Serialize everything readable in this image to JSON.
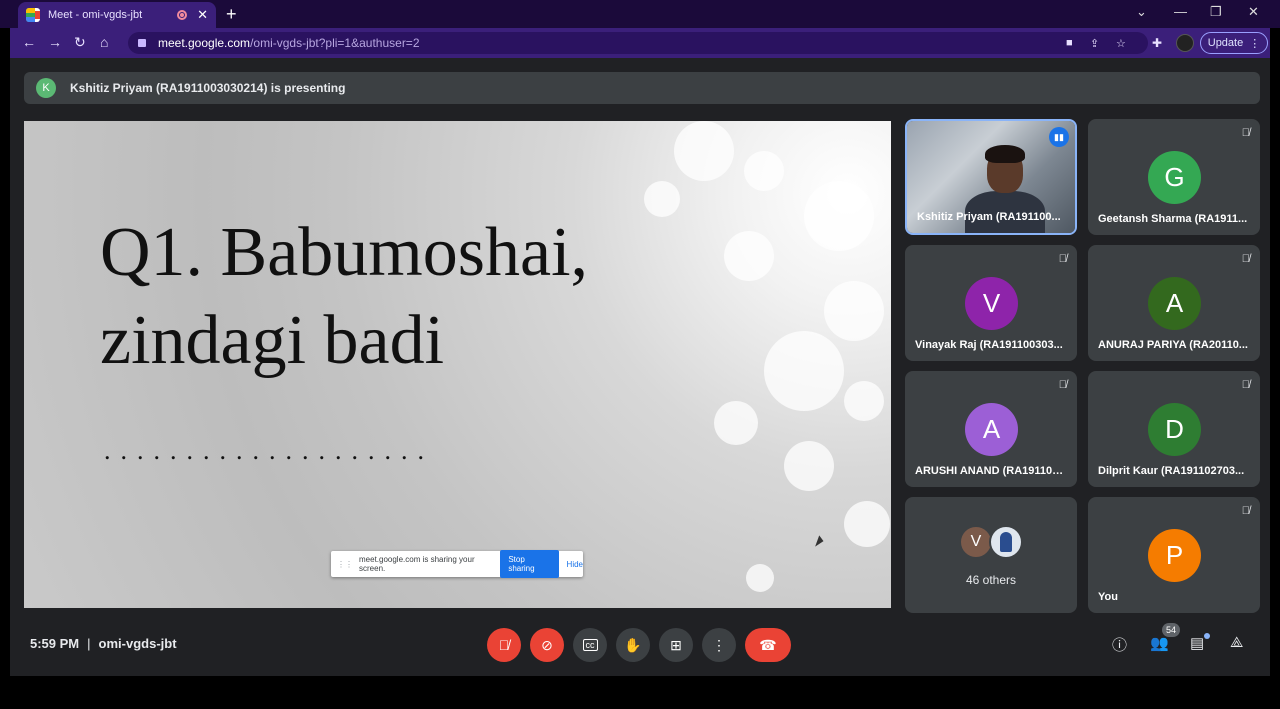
{
  "browser": {
    "tab_title": "Meet - omi-vgds-jbt",
    "new_tab": "+",
    "url_host": "meet.google.com",
    "url_path": "/omi-vgds-jbt?pli=1&authuser=2",
    "update_label": "Update"
  },
  "meet": {
    "banner_initial": "K",
    "banner_text": "Kshitiz Priyam (RA1911003030214) is presenting",
    "slide": {
      "line1": "Q1. Babumoshai,",
      "line2": "zindagi badi",
      "dots": "...................."
    },
    "share_bar": {
      "text": "meet.google.com is sharing your screen.",
      "stop": "Stop sharing",
      "hide": "Hide"
    },
    "participants": [
      {
        "name": "Kshitiz Priyam (RA191100...",
        "initial": "",
        "color": "",
        "video": true
      },
      {
        "name": "Geetansh Sharma (RA1911...",
        "initial": "G",
        "color": "#34a853"
      },
      {
        "name": "Vinayak Raj (RA191100303...",
        "initial": "V",
        "color": "#8e24aa"
      },
      {
        "name": "ANURAJ PARIYA (RA20110...",
        "initial": "A",
        "color": "#33691e"
      },
      {
        "name": "ARUSHI ANAND (RA191102...",
        "initial": "A",
        "color": "#9c5fd6"
      },
      {
        "name": "Dilprit Kaur (RA191102703...",
        "initial": "D",
        "color": "#2e7d32"
      },
      {
        "name": "You",
        "initial": "P",
        "color": "#f57c00"
      }
    ],
    "others": {
      "initial": "V",
      "label": "46 others"
    },
    "time": "5:59 PM",
    "separator": "|",
    "meeting_code": "omi-vgds-jbt",
    "people_count": "54"
  }
}
